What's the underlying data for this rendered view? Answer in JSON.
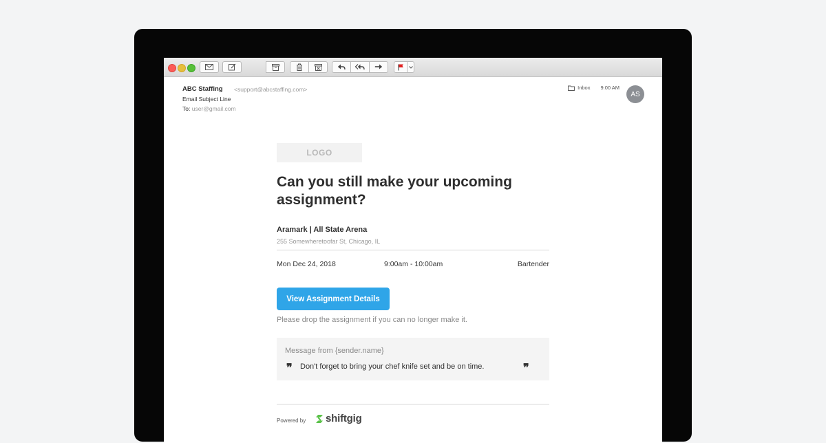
{
  "header": {
    "from_name": "ABC Staffing",
    "from_email": "<support@abcstaffing.com>",
    "subject": "Email Subject Line",
    "to_label": "To:",
    "to_address": "user@gmail.com",
    "folder": "Inbox",
    "time": "9:00 AM",
    "avatar_initials": "AS"
  },
  "toolbar": {
    "icons": [
      "mail-icon",
      "compose-icon",
      "archive-icon",
      "trash-icon",
      "junk-icon",
      "reply-icon",
      "reply-all-icon",
      "forward-icon",
      "flag-icon"
    ],
    "flag_color": "#e02020"
  },
  "email": {
    "logo_text": "LOGO",
    "title": "Can you still make your upcoming assignment?",
    "venue": "Aramark | All State Arena",
    "address": "255 Somewheretoofar St, Chicago, IL",
    "date": "Mon Dec 24, 2018",
    "time_range": "9:00am - 10:00am",
    "role": "Bartender",
    "cta_label": "View Assignment Details",
    "drop_note": "Please drop the assignment if you can no longer make it.",
    "message_from": "Message from {sender.name}",
    "message_text": "Don't forget to bring your chef knife set and be on time.",
    "quote_open": "❞",
    "quote_close": "❞",
    "powered_by": "Powered by",
    "brand": "shiftgig",
    "accent_color": "#2fa5e8",
    "brand_color": "#5cc24a"
  }
}
